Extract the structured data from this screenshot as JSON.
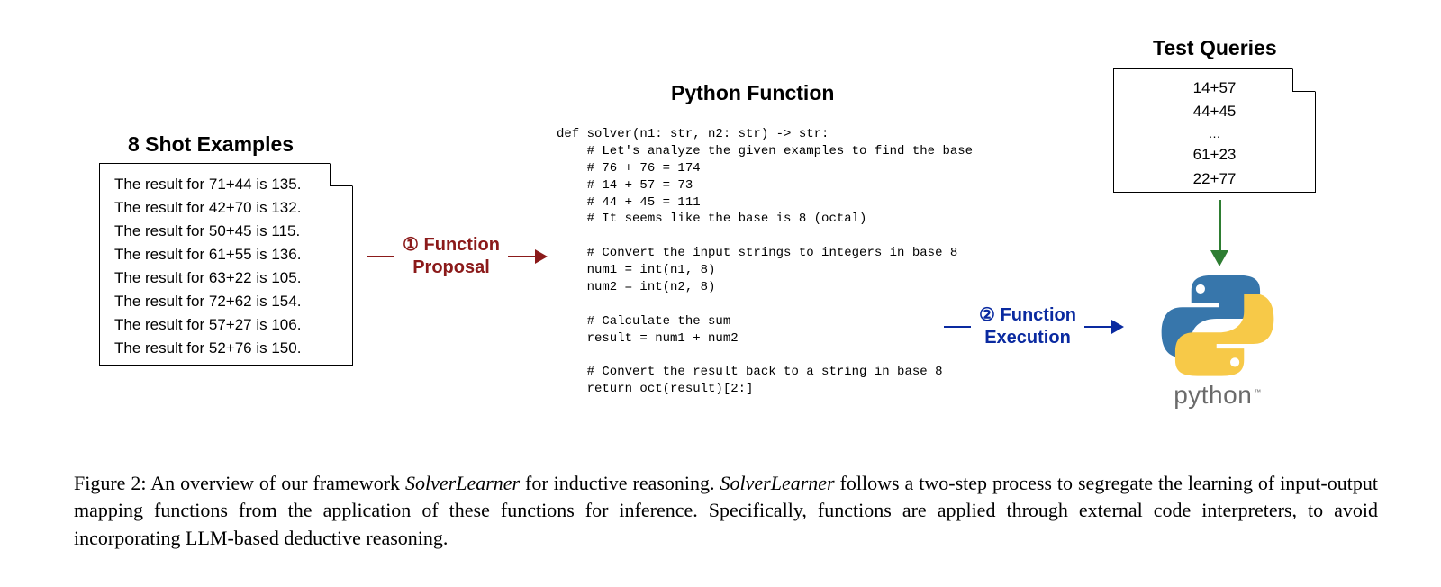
{
  "titles": {
    "shot": "8 Shot Examples",
    "pyfun": "Python Function",
    "tq": "Test Queries"
  },
  "shot_examples": [
    "The result for 71+44 is 135.",
    "The result for 42+70 is 132.",
    "The result for 50+45 is 115.",
    "The result for 61+55 is 136.",
    "The result for 63+22 is 105.",
    "The result for 72+62 is 154.",
    "The result for 57+27 is 106.",
    "The result for 52+76 is 150."
  ],
  "code_lines": {
    "l1": "def solver(n1: str, n2: str) -> str:",
    "l2": "    # Let's analyze the given examples to find the base",
    "l3": "    # 76 + 76 = 174",
    "l4": "    # 14 + 57 = 73",
    "l5": "    # 44 + 45 = 111",
    "l6": "    # It seems like the base is 8 (octal)",
    "l7": "",
    "l8": "    # Convert the input strings to integers in base 8",
    "l9": "    num1 = int(n1, 8)",
    "l10": "    num2 = int(n2, 8)",
    "l11": "",
    "l12": "    # Calculate the sum",
    "l13": "    result = num1 + num2",
    "l14": "",
    "l15": "    # Convert the result back to a string in base 8",
    "l16": "    return oct(result)[2:]"
  },
  "arrows": {
    "func_prop_num": "①",
    "func_prop_1": "Function",
    "func_prop_2": "Proposal",
    "func_exec_num": "②",
    "func_exec_1": "Function",
    "func_exec_2": "Execution"
  },
  "test_queries": {
    "q1": "14+57",
    "q2": "44+45",
    "dots": "…",
    "q3": "61+23",
    "q4": "22+77"
  },
  "python_label": "python",
  "python_tm": "™",
  "caption": {
    "fignum": "Figure 2:",
    "body_a": "An overview of our framework ",
    "em1": "SolverLearner",
    "body_b": " for inductive reasoning. ",
    "em2": "SolverLearner",
    "body_c": " follows a two-step process to segregate the learning of input-output mapping functions from the application of these functions for inference. Specifically, functions are applied through external code interpreters, to avoid incorporating LLM-based deductive reasoning."
  }
}
